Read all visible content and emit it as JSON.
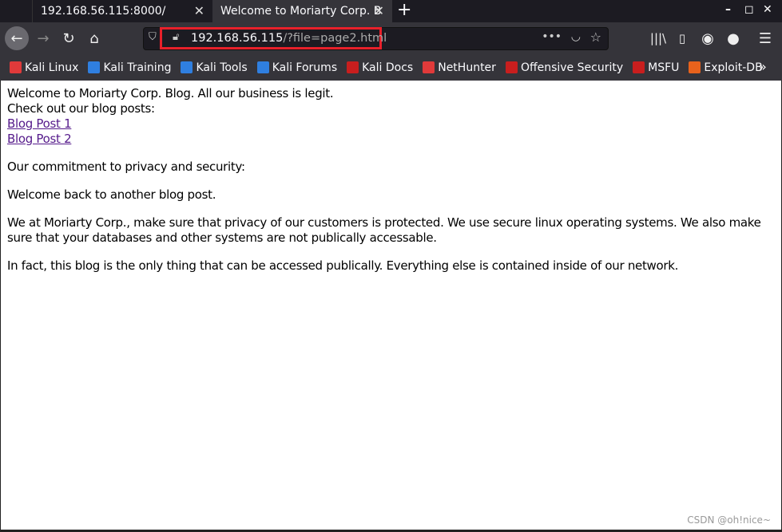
{
  "tabs": [
    {
      "label": "192.168.56.115:8000/",
      "active": false
    },
    {
      "label": "Welcome to Moriarty Corp. B",
      "active": true
    }
  ],
  "url": {
    "host": "192.168.56.115",
    "path": "/?file=page2.html"
  },
  "bookmarks": [
    {
      "label": "Kali Linux",
      "color": "#e03a3a"
    },
    {
      "label": "Kali Training",
      "color": "#2f7fe0"
    },
    {
      "label": "Kali Tools",
      "color": "#2f7fe0"
    },
    {
      "label": "Kali Forums",
      "color": "#2f7fe0"
    },
    {
      "label": "Kali Docs",
      "color": "#c81e1e"
    },
    {
      "label": "NetHunter",
      "color": "#e03a3a"
    },
    {
      "label": "Offensive Security",
      "color": "#c81e1e"
    },
    {
      "label": "MSFU",
      "color": "#c81e1e"
    },
    {
      "label": "Exploit-DB",
      "color": "#e8621c"
    }
  ],
  "page": {
    "intro1": "Welcome to Moriarty Corp. Blog. All our business is legit.",
    "intro2": "Check out our blog posts:",
    "links": [
      "Blog Post 1",
      "Blog Post 2"
    ],
    "heading": "Our commitment to privacy and security:",
    "p1": "Welcome back to another blog post.",
    "p2": "We at Moriarty Corp., make sure that privacy of our customers is protected. We use secure linux operating systems. We also make sure that your databases and other systems are not publically accessable.",
    "p3": "In fact, this blog is the only thing that can be accessed publically. Everything else is contained inside of our network."
  },
  "watermark": "CSDN @oh!nice~"
}
